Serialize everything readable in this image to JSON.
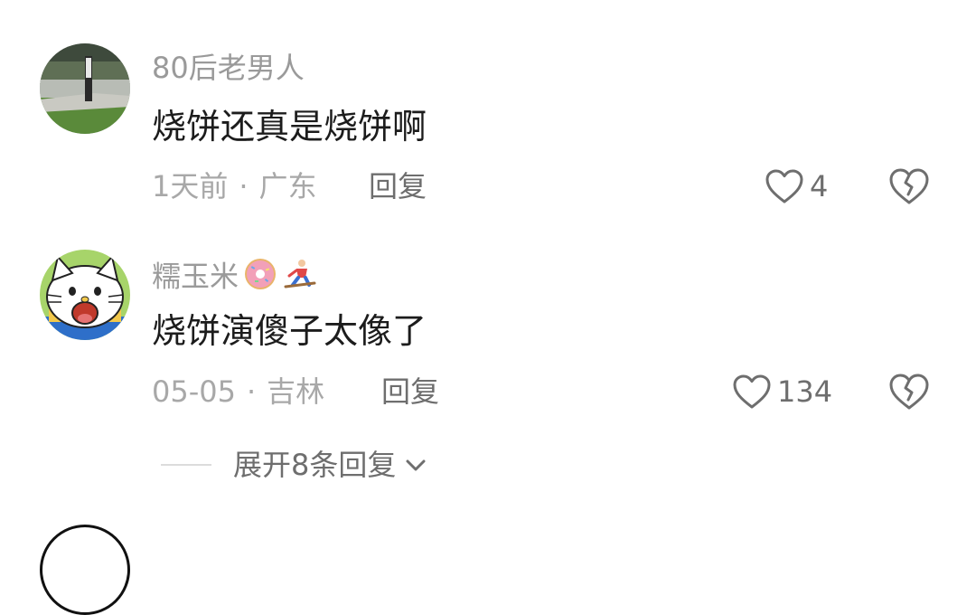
{
  "comments": [
    {
      "username": "80后老男人",
      "content": "烧饼还真是烧饼啊",
      "time": "1天前",
      "dot": "·",
      "location": "广东",
      "reply_label": "回复",
      "likes": "4"
    },
    {
      "username": "糯玉米",
      "content": "烧饼演傻子太像了",
      "time": "05-05",
      "dot": "·",
      "location": "吉林",
      "reply_label": "回复",
      "likes": "134"
    }
  ],
  "expand_replies": {
    "label": "展开8条回复"
  },
  "colors": {
    "text_primary": "#1c1c1c",
    "text_secondary": "#a8a8a8",
    "action_gray": "#6e6e6e"
  },
  "icons": {
    "like": "heart-outline-icon",
    "dislike": "broken-heart-icon",
    "expand": "chevron-down-icon"
  }
}
